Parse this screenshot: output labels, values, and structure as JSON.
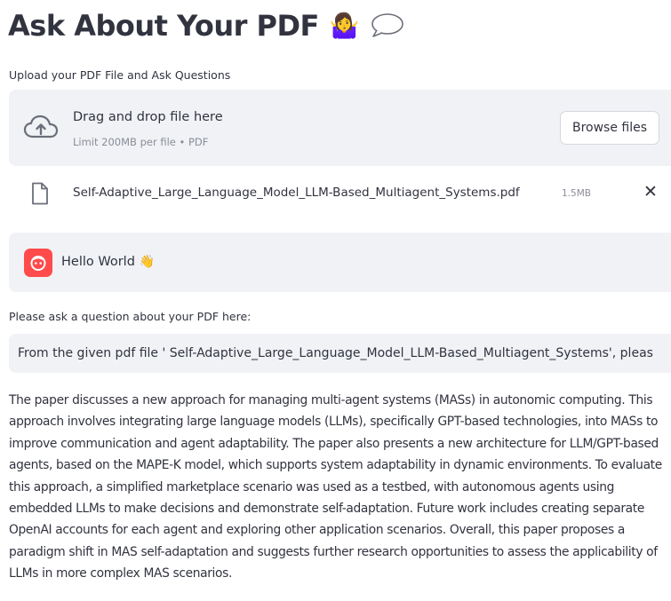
{
  "header": {
    "title": "Ask About Your PDF",
    "emoji": "🤷‍♀️",
    "bubble_icon": "speech-bubble-icon"
  },
  "uploader": {
    "label": "Upload your PDF File and Ask Questions",
    "drop_text": "Drag and drop file here",
    "limit_text": "Limit 200MB per file • PDF",
    "browse_label": "Browse files",
    "upload_icon": "cloud-upload-icon"
  },
  "uploaded_file": {
    "icon": "file-icon",
    "name": "Self-Adaptive_Large_Language_Model_LLM-Based_Multiagent_Systems.pdf",
    "size": "1.5MB",
    "remove_label": "✕"
  },
  "chat": {
    "avatar_icon": "bot-face-icon",
    "message": "Hello World",
    "emoji": "👋"
  },
  "question": {
    "label": "Please ask a question about your PDF here:",
    "value": "From the given pdf file ' Self-Adaptive_Large_Language_Model_LLM-Based_Multiagent_Systems', pleas"
  },
  "answer": {
    "text": "The paper discusses a new approach for managing multi-agent systems (MASs) in autonomic computing. This approach involves integrating large language models (LLMs), specifically GPT-based technologies, into MASs to improve communication and agent adaptability. The paper also presents a new architecture for LLM/GPT-based agents, based on the MAPE-K model, which supports system adaptability in dynamic environments. To evaluate this approach, a simplified marketplace scenario was used as a testbed, with autonomous agents using embedded LLMs to make decisions and demonstrate self-adaptation. Future work includes creating separate OpenAI accounts for each agent and exploring other application scenarios. Overall, this paper proposes a paradigm shift in MAS self-adaptation and suggests further research opportunities to assess the applicability of LLMs in more complex MAS scenarios."
  },
  "colors": {
    "text": "#31333f",
    "muted": "#8b8d98",
    "panel": "#f0f2f6",
    "avatar": "#ff4b4b"
  }
}
